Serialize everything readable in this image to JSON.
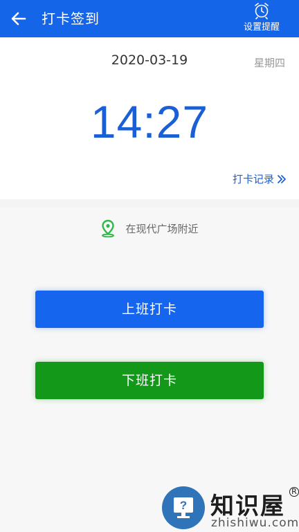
{
  "header": {
    "title": "打卡签到",
    "alarm_label": "设置提醒"
  },
  "clock_card": {
    "date": "2020-03-19",
    "weekday": "星期四",
    "time": "14:27",
    "records_link": "打卡记录"
  },
  "location": {
    "text": "在现代广场附近"
  },
  "actions": {
    "clock_in": "上班打卡",
    "clock_out": "下班打卡"
  },
  "watermark": {
    "brand": "知识屋",
    "reg": "R",
    "domain": "zhishiwu.com"
  },
  "colors": {
    "primary": "#1565e8",
    "clock_in_button": "#1565ef",
    "clock_out_button": "#14981a",
    "location_pin": "#2db84a"
  }
}
